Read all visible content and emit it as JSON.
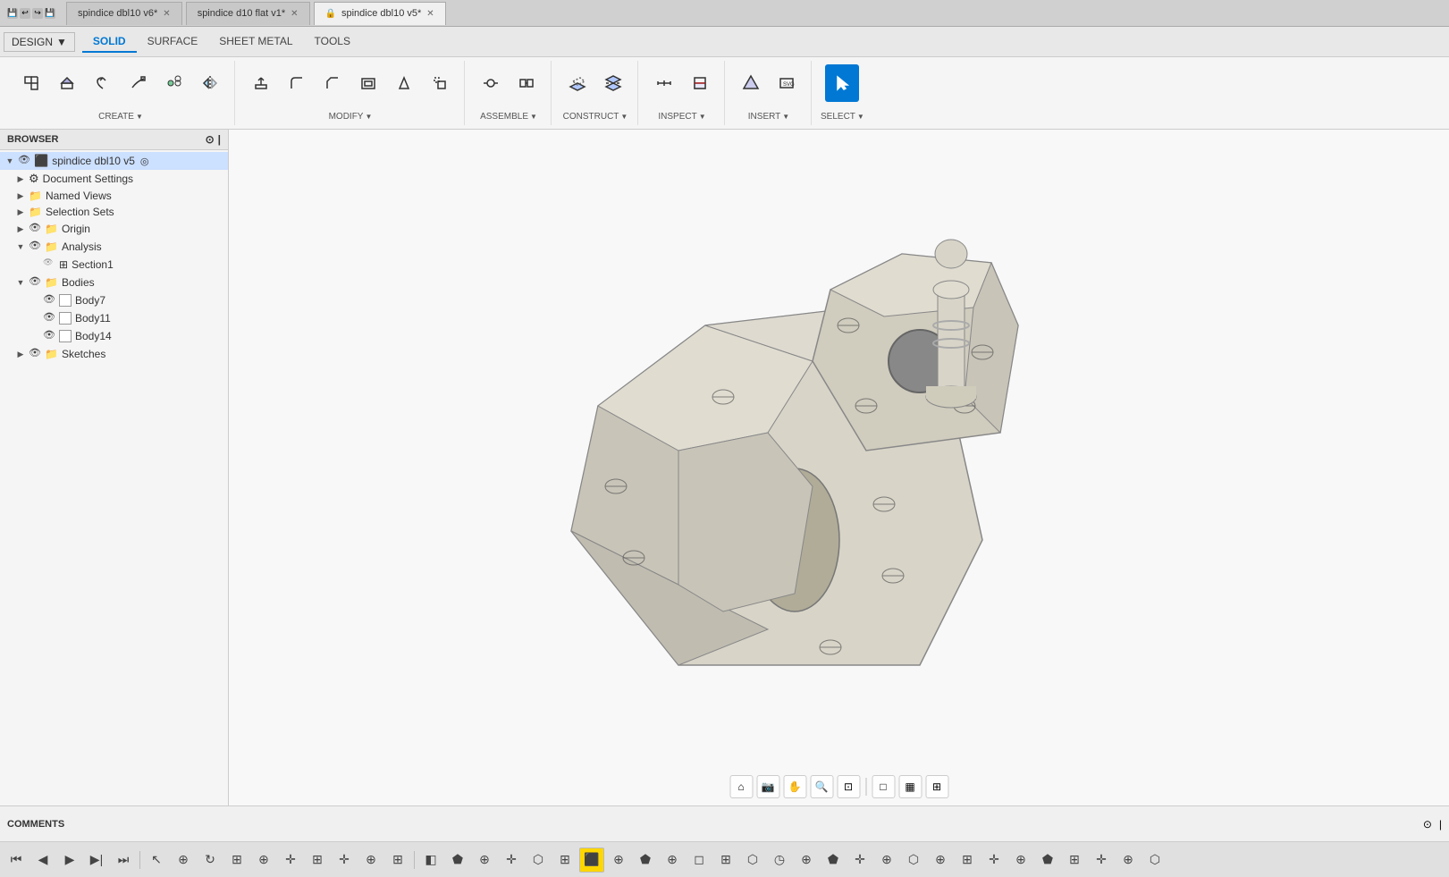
{
  "titlebar": {
    "tabs": [
      {
        "label": "spindice dbl10 v6*",
        "active": false,
        "lock": false
      },
      {
        "label": "spindice d10 flat v1*",
        "active": false,
        "lock": false
      },
      {
        "label": "spindice dbl10 v5*",
        "active": true,
        "lock": true
      }
    ]
  },
  "toolbar": {
    "mode_tabs": [
      "SOLID",
      "SURFACE",
      "SHEET METAL",
      "TOOLS"
    ],
    "active_mode": "SOLID",
    "design_label": "DESIGN",
    "groups": [
      {
        "name": "CREATE",
        "buttons": [
          {
            "icon": "new-component",
            "label": ""
          },
          {
            "icon": "extrude",
            "label": ""
          },
          {
            "icon": "revolve",
            "label": ""
          },
          {
            "icon": "sweep",
            "label": ""
          },
          {
            "icon": "pattern",
            "label": ""
          },
          {
            "icon": "mirror",
            "label": ""
          }
        ]
      },
      {
        "name": "MODIFY",
        "buttons": [
          {
            "icon": "press-pull",
            "label": ""
          },
          {
            "icon": "fillet",
            "label": ""
          },
          {
            "icon": "chamfer",
            "label": ""
          },
          {
            "icon": "shell",
            "label": ""
          },
          {
            "icon": "draft",
            "label": ""
          },
          {
            "icon": "scale",
            "label": ""
          }
        ]
      },
      {
        "name": "ASSEMBLE",
        "buttons": [
          {
            "icon": "joint",
            "label": ""
          },
          {
            "icon": "rigid-group",
            "label": ""
          }
        ]
      },
      {
        "name": "CONSTRUCT",
        "buttons": [
          {
            "icon": "offset-plane",
            "label": ""
          },
          {
            "icon": "midplane",
            "label": ""
          }
        ]
      },
      {
        "name": "INSPECT",
        "buttons": [
          {
            "icon": "measure",
            "label": ""
          },
          {
            "icon": "section-analysis",
            "label": ""
          }
        ]
      },
      {
        "name": "INSERT",
        "buttons": [
          {
            "icon": "insert-mesh",
            "label": ""
          },
          {
            "icon": "insert-svg",
            "label": ""
          }
        ]
      },
      {
        "name": "SELECT",
        "buttons": [
          {
            "icon": "select",
            "label": "",
            "active": true
          }
        ]
      }
    ]
  },
  "browser": {
    "title": "BROWSER",
    "tree": [
      {
        "level": 0,
        "arrow": "▼",
        "eye": true,
        "box": true,
        "folder": true,
        "label": "spindice dbl10 v5",
        "active": true
      },
      {
        "level": 1,
        "arrow": "▶",
        "eye": false,
        "box": false,
        "folder": true,
        "label": "Document Settings"
      },
      {
        "level": 1,
        "arrow": "▶",
        "eye": false,
        "box": false,
        "folder": true,
        "label": "Named Views"
      },
      {
        "level": 1,
        "arrow": "▶",
        "eye": false,
        "box": false,
        "folder": true,
        "label": "Selection Sets"
      },
      {
        "level": 1,
        "arrow": "▶",
        "eye": true,
        "box": true,
        "folder": true,
        "label": "Origin"
      },
      {
        "level": 1,
        "arrow": "▼",
        "eye": true,
        "box": true,
        "folder": true,
        "label": "Analysis"
      },
      {
        "level": 2,
        "arrow": "",
        "eye": true,
        "box": false,
        "folder": false,
        "label": "Section1",
        "section": true
      },
      {
        "level": 1,
        "arrow": "▼",
        "eye": true,
        "box": true,
        "folder": true,
        "label": "Bodies"
      },
      {
        "level": 2,
        "arrow": "",
        "eye": true,
        "box": true,
        "folder": false,
        "label": "Body7"
      },
      {
        "level": 2,
        "arrow": "",
        "eye": true,
        "box": true,
        "folder": false,
        "label": "Body11"
      },
      {
        "level": 2,
        "arrow": "",
        "eye": true,
        "box": true,
        "folder": false,
        "label": "Body14"
      },
      {
        "level": 1,
        "arrow": "▶",
        "eye": true,
        "box": true,
        "folder": true,
        "label": "Sketches"
      }
    ]
  },
  "viewport": {
    "background": "#f0f0f0"
  },
  "bottom": {
    "comments_label": "COMMENTS",
    "toolbar_buttons": 50
  },
  "construct_label": "CONSTRUCT >",
  "icons": {
    "eye": "👁",
    "gear": "⚙",
    "folder": "📁",
    "arrow_right": "▶",
    "arrow_down": "▼"
  }
}
